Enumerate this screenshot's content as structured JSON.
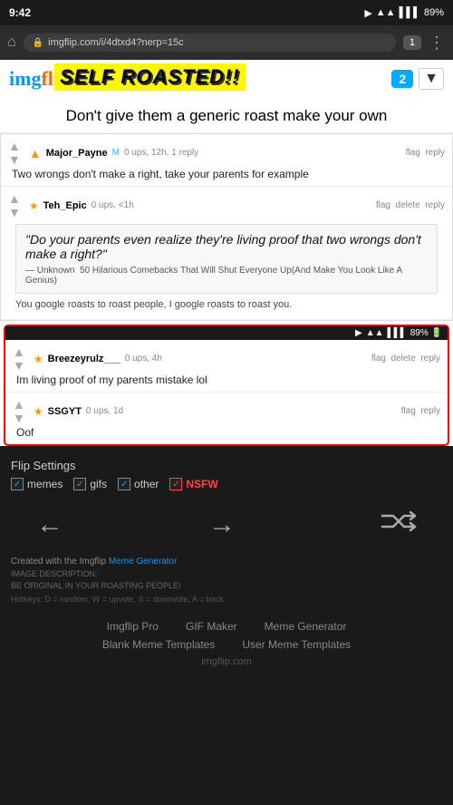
{
  "status_bar": {
    "time": "9:42",
    "battery": "89%",
    "signal_icons": "🔊 📶 📶 🔋"
  },
  "browser": {
    "url": "imgflip.com/i/4dtxd4?nerp=15c",
    "tab_count": "1"
  },
  "header": {
    "logo": "imgflip",
    "overlay_text": "SELF ROASTED!!",
    "badge": "2"
  },
  "post": {
    "title": "Don't give them a generic roast make your own"
  },
  "comments": [
    {
      "username": "Major_Payne",
      "gender": "M",
      "votes": "0 ups",
      "time": "12h",
      "replies": "1 reply",
      "text": "Two wrongs don't make a right, take your parents for example",
      "flags": "flag  reply"
    },
    {
      "username": "Teh_Epic",
      "votes": "0 ups",
      "time": "1h",
      "flags": "flag  delete  reply",
      "quote_text": "\"Do your parents even realize they're living proof that two wrongs don't make a right?\"",
      "quote_source": "— Unknown  50 Hilarious Comebacks That Will Shut Everyone Up(And Make You Look Like A Genius)",
      "google_text": "You google roasts to roast people, I google roasts to roast you."
    }
  ],
  "highlighted_comments": [
    {
      "username": "Breezeyrulz___",
      "votes": "0 ups",
      "time": "4h",
      "flags": "flag  delete  reply",
      "text": "Im living proof of my parents mistake lol"
    },
    {
      "username": "SSGYT",
      "votes": "0 ups",
      "time": "1d",
      "flags": "flag  reply",
      "text": "Oof"
    }
  ],
  "flip_settings": {
    "title": "Flip Settings",
    "checkboxes": [
      {
        "label": "memes",
        "checked": true
      },
      {
        "label": "gifs",
        "checked": true
      },
      {
        "label": "other",
        "checked": true
      },
      {
        "label": "NSFW",
        "checked": true,
        "nsfw": true
      }
    ]
  },
  "footer": {
    "created_with": "Created with the Imgflip ",
    "meme_generator_link": "Meme Generator",
    "image_desc": "IMAGE DESCRIPTION:",
    "image_desc_text": "BE ORIGINAL IN YOUR ROASTING PEOPLE!",
    "hotkeys": "Hotkeys: D = random, W = upvote, S = downvote, A = back"
  },
  "footer_links": {
    "row1": [
      "Imgflip Pro",
      "GIF Maker",
      "Meme Generator"
    ],
    "row2": [
      "Blank Meme Templates",
      "User Meme Templates"
    ],
    "brand": "imgflip.com"
  }
}
